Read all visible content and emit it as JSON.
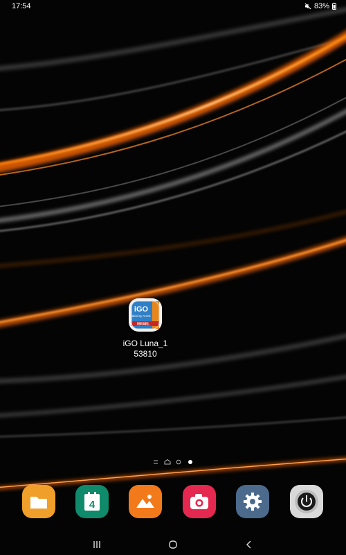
{
  "status_bar": {
    "time": "17:54",
    "battery": "83%",
    "icons": [
      "mute-icon",
      "battery-icon"
    ]
  },
  "home_screen": {
    "app": {
      "label": "iGO Luna_1\n53810",
      "icon_text_top": "iGO",
      "icon_text_middle": "Skin by Arrick",
      "icon_text_bottom": "ISRAEL"
    }
  },
  "page_indicator": {
    "pages": 4,
    "current": 4
  },
  "dock": {
    "apps": [
      {
        "name": "my-files-icon",
        "color": "#f0a02a"
      },
      {
        "name": "calendar-icon",
        "color": "#0f8a6a",
        "text": "4"
      },
      {
        "name": "gallery-icon",
        "color": "#f27a1a"
      },
      {
        "name": "camera-icon",
        "color": "#e5284f"
      },
      {
        "name": "settings-icon",
        "color": "#4b6a8c"
      },
      {
        "name": "power-icon",
        "color": "#d9d9d9"
      }
    ]
  },
  "nav_bar": {
    "buttons": [
      "recents-icon",
      "home-icon",
      "back-icon"
    ]
  }
}
